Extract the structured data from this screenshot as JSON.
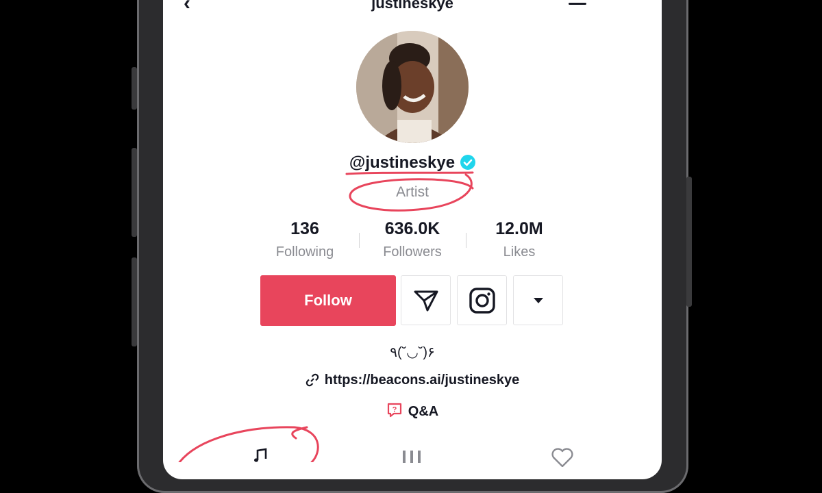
{
  "topbar": {
    "username": "justineskye",
    "back_glyph": "‹"
  },
  "profile": {
    "handle": "@justineskye",
    "category": "Artist",
    "verified": true
  },
  "stats": [
    {
      "value": "136",
      "label": "Following"
    },
    {
      "value": "636.0K",
      "label": "Followers"
    },
    {
      "value": "12.0M",
      "label": "Likes"
    }
  ],
  "actions": {
    "follow_label": "Follow"
  },
  "bio": {
    "emoticon": "٩(˘◡˘)۶",
    "link": "https://beacons.ai/justineskye",
    "qa_label": "Q&A"
  },
  "tabs": [
    {
      "icon": "music-note-icon"
    },
    {
      "icon": "grid-icon"
    },
    {
      "icon": "heart-icon"
    }
  ],
  "colors": {
    "follow_button": "#e8455c",
    "verified_badge": "#20d5ec",
    "annotation_ink": "#e8455c",
    "qa_icon": "#e8455c"
  }
}
